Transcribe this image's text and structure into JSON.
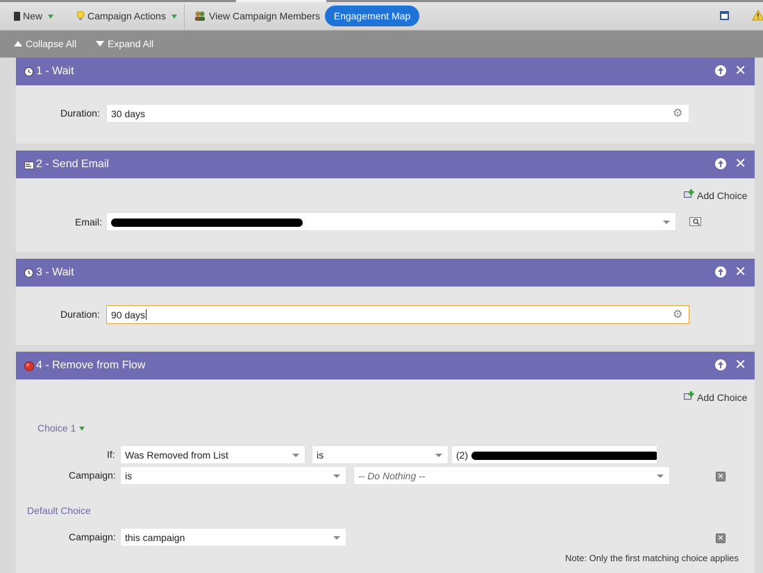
{
  "toolbar": {
    "new_label": "New",
    "campaign_actions_label": "Campaign Actions",
    "view_members_label": "View Campaign Members",
    "engagement_map_label": "Engagement Map"
  },
  "subbar": {
    "collapse_label": "Collapse All",
    "expand_label": "Expand All"
  },
  "steps": [
    {
      "title": "1 - Wait",
      "duration_label": "Duration:",
      "duration_value": "30 days"
    },
    {
      "title": "2 - Send Email",
      "add_choice": "Add Choice",
      "email_label": "Email:",
      "email_value": ""
    },
    {
      "title": "3 - Wait",
      "duration_label": "Duration:",
      "duration_value": "90 days"
    },
    {
      "title": "4 - Remove from Flow",
      "add_choice": "Add Choice",
      "choice1_label": "Choice 1",
      "if_label": "If:",
      "if_field": "Was Removed from List",
      "if_operator": "is",
      "if_value_prefix": "(2)",
      "campaign_label": "Campaign:",
      "campaign_operator": "is",
      "campaign_action": "-- Do Nothing --",
      "default_choice_label": "Default Choice",
      "default_campaign_label": "Campaign:",
      "default_campaign_value": "this campaign",
      "note": "Note: Only the first matching choice applies"
    }
  ],
  "colors": {
    "header_purple": "#6f6cb4",
    "pill_blue": "#1e73d8",
    "focus_orange": "#e8a33d"
  }
}
